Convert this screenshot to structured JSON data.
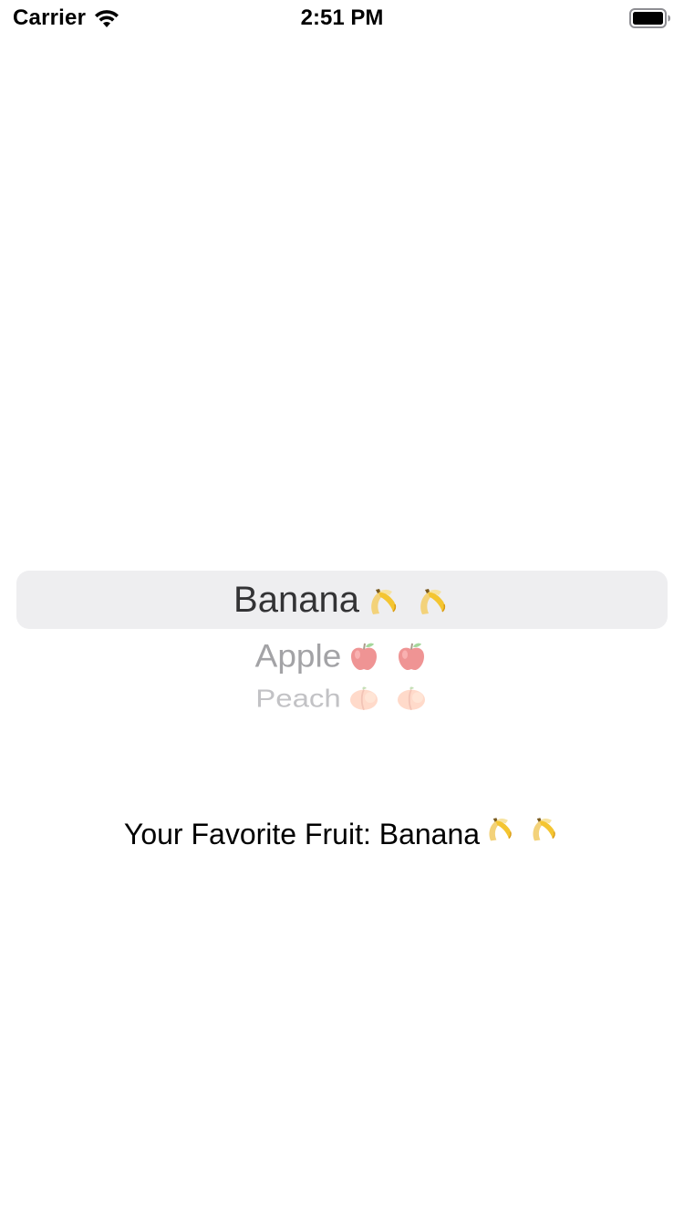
{
  "status_bar": {
    "carrier": "Carrier",
    "time": "2:51 PM",
    "icons": [
      "wifi-icon",
      "battery-icon"
    ]
  },
  "picker": {
    "options": [
      {
        "label": "Banana",
        "emoji": "banana",
        "state": "selected"
      },
      {
        "label": "Apple",
        "emoji": "apple",
        "state": "unselected"
      },
      {
        "label": "Peach",
        "emoji": "peach",
        "state": "unselected"
      }
    ],
    "selected_index": 0
  },
  "result": {
    "prefix": "Your Favorite Fruit: ",
    "value": "Banana"
  },
  "colors": {
    "background": "#ffffff",
    "picker_highlight": "#eeeef0",
    "selected_text": "#333335",
    "unselected_text": "#a3a3a6"
  }
}
